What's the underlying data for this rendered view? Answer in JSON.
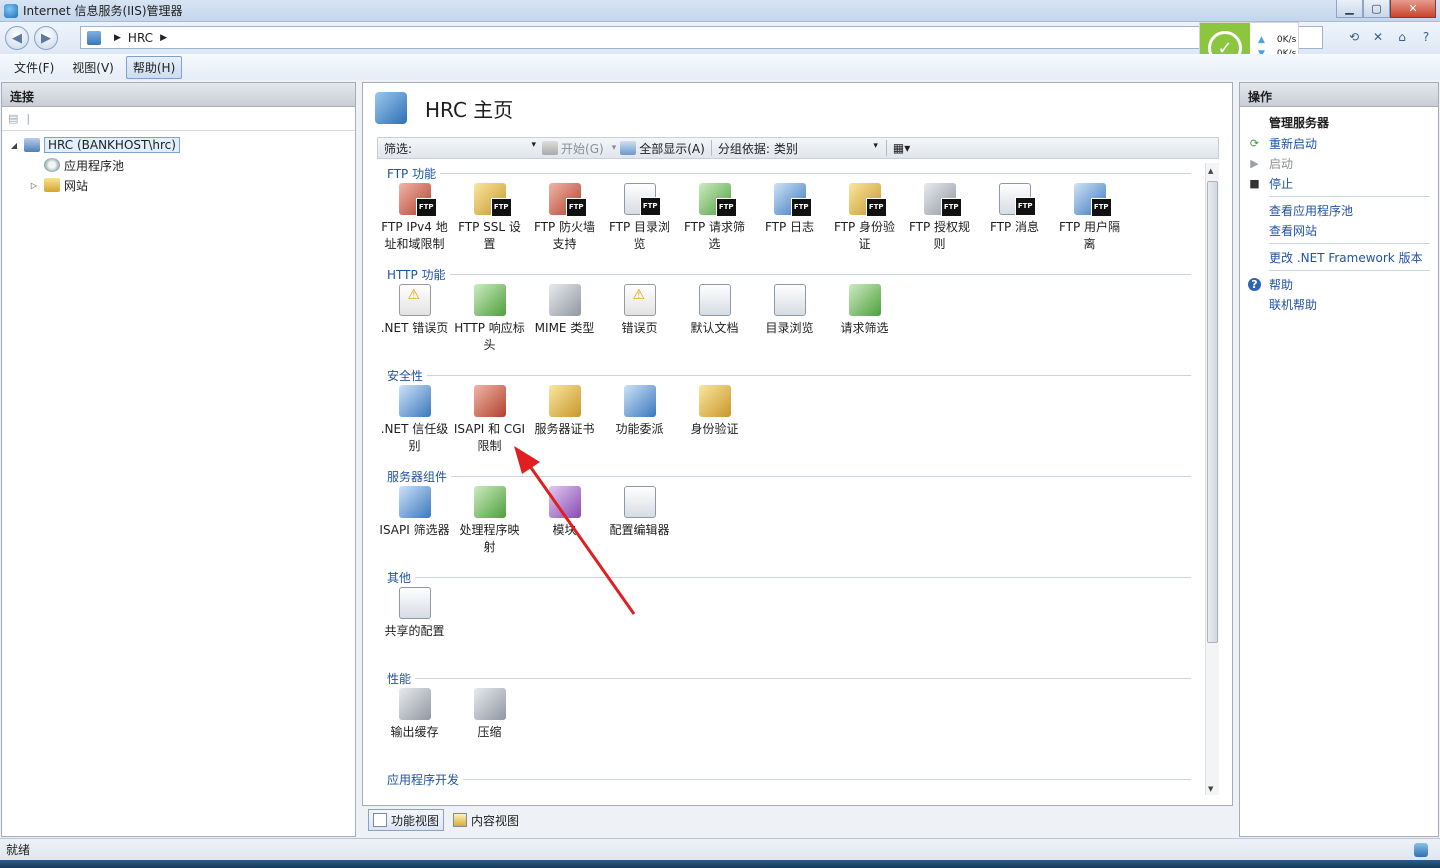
{
  "window": {
    "title": "Internet 信息服务(IIS)管理器"
  },
  "address": {
    "segment": "HRC"
  },
  "net_widget": {
    "up": "0K/s",
    "down": "0K/s"
  },
  "menu": {
    "file": "文件(F)",
    "view": "视图(V)",
    "help": "帮助(H)"
  },
  "left_pane": {
    "title": "连接",
    "tree": {
      "server": "HRC (BANKHOST\\hrc)",
      "app_pools": "应用程序池",
      "sites": "网站"
    }
  },
  "center": {
    "title": "HRC 主页",
    "filter_label": "筛选:",
    "start": "开始(G)",
    "show_all": "全部显示(A)",
    "group_by_label": "分组依据:",
    "group_by_value": "类别",
    "groups": [
      {
        "title": "FTP 功能",
        "items": [
          {
            "l1": "FTP IPv4 地",
            "l2": "址和域限制",
            "icon": "ftp-ip-icon"
          },
          {
            "l1": "FTP SSL 设",
            "l2": "置",
            "icon": "ftp-ssl-icon"
          },
          {
            "l1": "FTP 防火墙",
            "l2": "支持",
            "icon": "ftp-firewall-icon"
          },
          {
            "l1": "FTP 目录浏",
            "l2": "览",
            "icon": "ftp-dir-icon"
          },
          {
            "l1": "FTP 请求筛",
            "l2": "选",
            "icon": "ftp-filter-icon"
          },
          {
            "l1": "FTP 日志",
            "l2": "",
            "icon": "ftp-log-icon"
          },
          {
            "l1": "FTP 身份验",
            "l2": "证",
            "icon": "ftp-auth-icon"
          },
          {
            "l1": "FTP 授权规",
            "l2": "则",
            "icon": "ftp-authz-icon"
          },
          {
            "l1": "FTP 消息",
            "l2": "",
            "icon": "ftp-message-icon"
          },
          {
            "l1": "FTP 用户隔",
            "l2": "离",
            "icon": "ftp-isolation-icon"
          }
        ]
      },
      {
        "title": "HTTP 功能",
        "items": [
          {
            "l1": ".NET 错误页",
            "l2": "",
            "icon": "net-error-icon"
          },
          {
            "l1": "HTTP 响应标",
            "l2": "头",
            "icon": "http-header-icon"
          },
          {
            "l1": "MIME 类型",
            "l2": "",
            "icon": "mime-icon"
          },
          {
            "l1": "错误页",
            "l2": "",
            "icon": "error-page-icon"
          },
          {
            "l1": "默认文档",
            "l2": "",
            "icon": "default-doc-icon"
          },
          {
            "l1": "目录浏览",
            "l2": "",
            "icon": "dir-browse-icon"
          },
          {
            "l1": "请求筛选",
            "l2": "",
            "icon": "request-filter-icon"
          }
        ]
      },
      {
        "title": "安全性",
        "items": [
          {
            "l1": ".NET 信任级",
            "l2": "别",
            "icon": "net-trust-icon"
          },
          {
            "l1": "ISAPI 和 CGI",
            "l2": "限制",
            "icon": "isapi-cgi-icon"
          },
          {
            "l1": "服务器证书",
            "l2": "",
            "icon": "certificate-icon"
          },
          {
            "l1": "功能委派",
            "l2": "",
            "icon": "delegation-icon"
          },
          {
            "l1": "身份验证",
            "l2": "",
            "icon": "auth-icon"
          }
        ]
      },
      {
        "title": "服务器组件",
        "items": [
          {
            "l1": "ISAPI 筛选器",
            "l2": "",
            "icon": "isapi-filter-icon"
          },
          {
            "l1": "处理程序映",
            "l2": "射",
            "icon": "handler-mapping-icon"
          },
          {
            "l1": "模块",
            "l2": "",
            "icon": "modules-icon"
          },
          {
            "l1": "配置编辑器",
            "l2": "",
            "icon": "config-editor-icon"
          }
        ]
      },
      {
        "title": "其他",
        "items": [
          {
            "l1": "共享的配置",
            "l2": "",
            "icon": "shared-config-icon"
          }
        ]
      },
      {
        "title": "性能",
        "items": [
          {
            "l1": "输出缓存",
            "l2": "",
            "icon": "output-cache-icon"
          },
          {
            "l1": "压缩",
            "l2": "",
            "icon": "compression-icon"
          }
        ]
      },
      {
        "title": "应用程序开发",
        "items": []
      }
    ],
    "tabs": {
      "features": "功能视图",
      "content": "内容视图"
    }
  },
  "right_pane": {
    "title": "操作",
    "manage_server": "管理服务器",
    "restart": "重新启动",
    "start": "启动",
    "stop": "停止",
    "view_pools": "查看应用程序池",
    "view_sites": "查看网站",
    "change_framework": "更改 .NET Framework 版本",
    "help": "帮助",
    "online_help": "联机帮助"
  },
  "status": {
    "text": "就绪"
  },
  "colors": {
    "link": "#2153a3",
    "group_title": "#2153a3",
    "arrow": "#e02020"
  }
}
